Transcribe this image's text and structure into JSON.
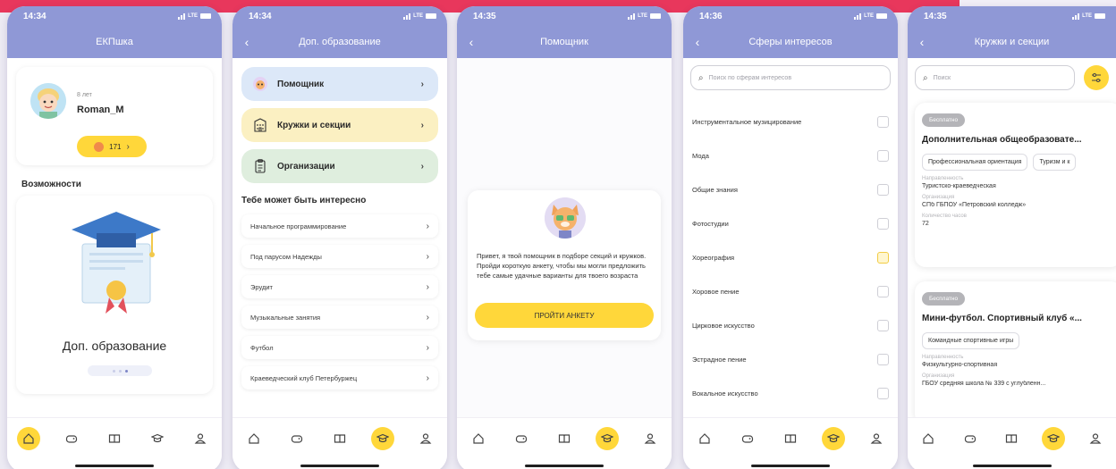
{
  "screens": {
    "home": {
      "time": "14:34",
      "title": "ЕКПшка",
      "age": "8 лет",
      "username": "Roman_M",
      "coins": "171",
      "section": "Возможности",
      "feature_title": "Доп. образование"
    },
    "education": {
      "time": "14:34",
      "title": "Доп. образование",
      "menu": [
        {
          "label": "Помощник",
          "color": "#dce8f8"
        },
        {
          "label": "Кружки и секции",
          "color": "#fbf0c2"
        },
        {
          "label": "Организации",
          "color": "#dfeede"
        }
      ],
      "section": "Тебе может быть интересно",
      "items": [
        "Начальное программирование",
        "Под парусом Надежды",
        "Эрудит",
        "Музыкальные занятия",
        "Футбол",
        "Краеведческий клуб Петербуржец"
      ]
    },
    "assistant": {
      "time": "14:35",
      "title": "Помощник",
      "text": "Привет, я твой помощник в подборе секций и кружков. Пройди короткую анкету, чтобы мы могли предложить тебе самые удачные варианты для твоего возраста",
      "button": "ПРОЙТИ АНКЕТУ"
    },
    "interests": {
      "time": "14:36",
      "title": "Сферы интересов",
      "search_placeholder": "Поиск по сферам интересов",
      "items": [
        "Инструментальное музицирование",
        "Мода",
        "Общие знания",
        "Фотостудии",
        "Хореография",
        "Хоровое пение",
        "Цирковое искусство",
        "Эстрадное пение",
        "Вокальное искусство"
      ]
    },
    "clubs": {
      "time": "14:35",
      "title": "Кружки и секции",
      "search_placeholder": "Поиск",
      "cards": [
        {
          "badge": "Бесплатно",
          "title": "Дополнительная общеобразовате...",
          "tags": [
            "Профессиональная ориентация",
            "Туризм и к"
          ],
          "direction_label": "Направленность",
          "direction": "Туристско-краеведческая",
          "org_label": "Организация",
          "org": "СПб ГБПОУ «Петровский колледж»",
          "hours_label": "Количество часов",
          "hours": "72"
        },
        {
          "badge": "Бесплатно",
          "title": "Мини-футбол. Спортивный клуб «...",
          "tags": [
            "Командные спортивные игры"
          ],
          "direction_label": "Направленность",
          "direction": "Физкультурно-спортивная",
          "org_label": "Организация",
          "org": "ГБОУ средняя школа № 339 с углубленн..."
        }
      ]
    }
  },
  "colors": {
    "header": "#8f98d6",
    "accent": "#ffd73a",
    "brand_red": "#e8375c"
  },
  "tabbar_icons": [
    "home-icon",
    "gamepad-icon",
    "book-icon",
    "graduation-cap-icon",
    "profile-icon"
  ],
  "tabbar_active": [
    0,
    3,
    3,
    3,
    3
  ]
}
